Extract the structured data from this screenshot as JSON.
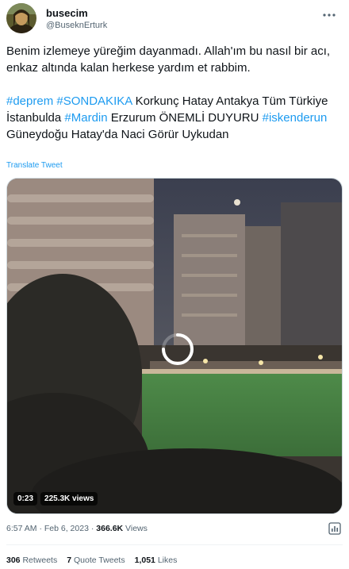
{
  "author": {
    "display_name": "busecim",
    "handle": "@BuseknErturk",
    "avatar_icon": "mona-lisa-avatar-icon"
  },
  "tweet": {
    "paragraph1": "Benim izlemeye yüreğim dayanmadı. Allah'ım bu nasıl bir acı, enkaz altında kalan herkese yardım et rabbim.",
    "p2_segments": [
      {
        "text": "#deprem",
        "hashtag": true
      },
      {
        "text": " ",
        "hashtag": false
      },
      {
        "text": "#SONDAKIKA",
        "hashtag": true
      },
      {
        "text": " Korkunç Hatay Antakya Tüm Türkiye İstanbulda ",
        "hashtag": false
      },
      {
        "text": "#Mardin",
        "hashtag": true
      },
      {
        "text": " Erzurum ÖNEMLİ DUYURU ",
        "hashtag": false
      },
      {
        "text": "#iskenderun",
        "hashtag": true
      },
      {
        "text": " Güneydoğu Hatay'da Naci Görür Uykudan",
        "hashtag": false
      }
    ],
    "translate_label": "Translate Tweet"
  },
  "video": {
    "time": "0:23",
    "views": "225.3K views"
  },
  "meta": {
    "time": "6:57 AM",
    "separator": "·",
    "date": "Feb 6, 2023",
    "views_count": "366.6K",
    "views_label": "Views"
  },
  "stats": {
    "retweets_count": "306",
    "retweets_label": "Retweets",
    "quotes_count": "7",
    "quotes_label": "Quote Tweets",
    "likes_count": "1,051",
    "likes_label": "Likes"
  },
  "colors": {
    "accent": "#1d9bf0",
    "text": "#0f1419",
    "secondary": "#536471"
  }
}
